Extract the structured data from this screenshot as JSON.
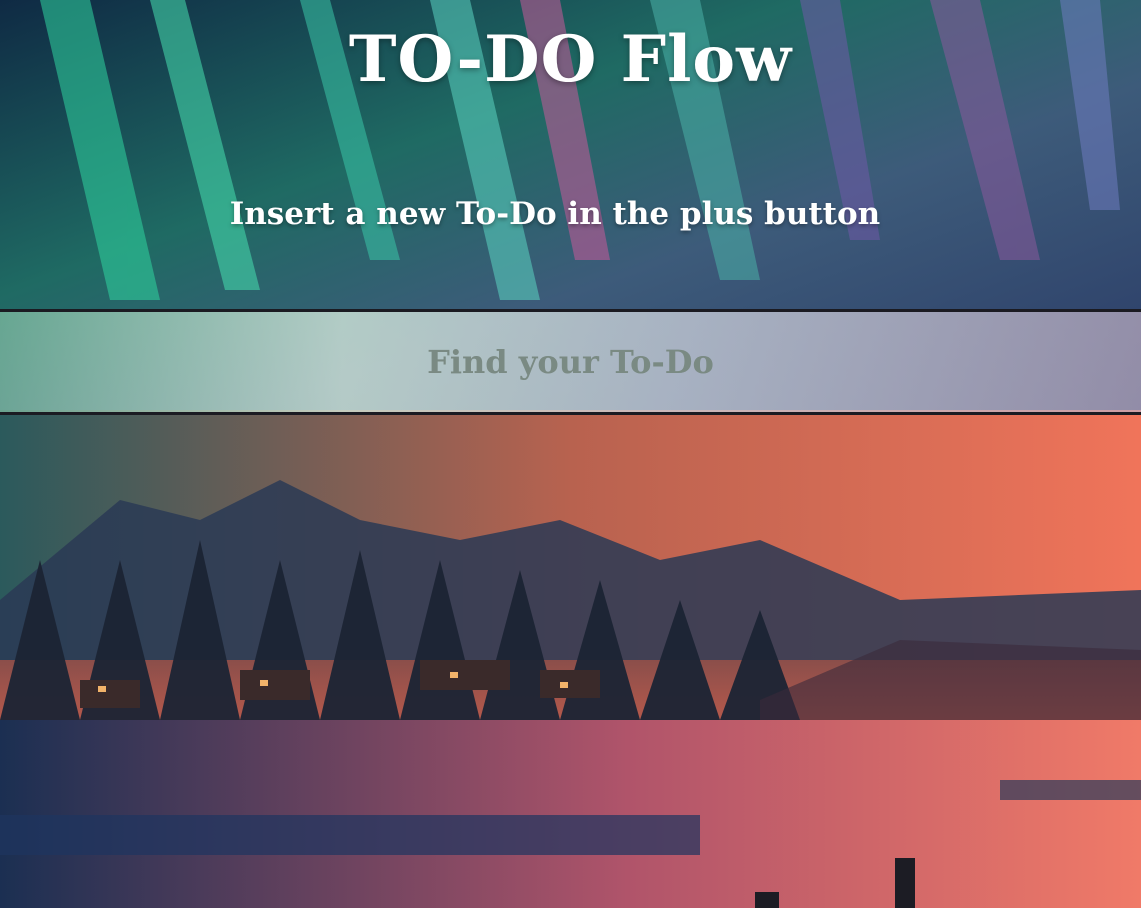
{
  "app": {
    "title": "TO-DO Flow",
    "subtitle": "Insert a new To-Do in the plus button"
  },
  "search": {
    "placeholder": "Find your To-Do",
    "value": ""
  },
  "colors": {
    "text": "#ffffff",
    "band_border": "#1b1b22",
    "placeholder": "#7a8a83"
  }
}
